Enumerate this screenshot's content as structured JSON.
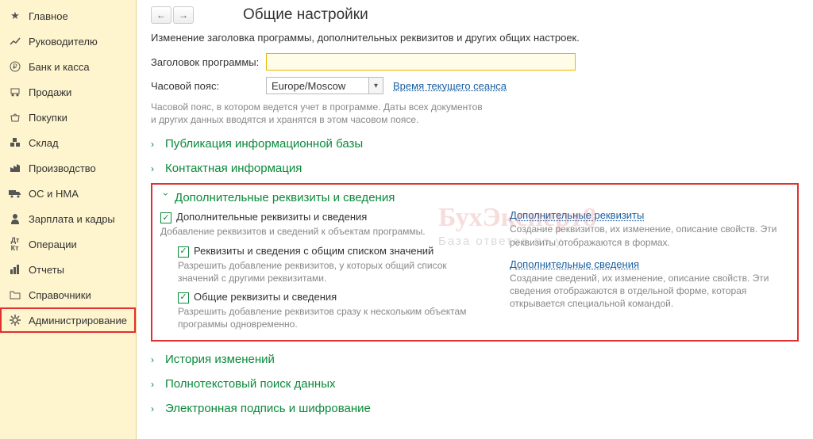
{
  "sidebar": {
    "items": [
      {
        "label": "Главное"
      },
      {
        "label": "Руководителю"
      },
      {
        "label": "Банк и касса"
      },
      {
        "label": "Продажи"
      },
      {
        "label": "Покупки"
      },
      {
        "label": "Склад"
      },
      {
        "label": "Производство"
      },
      {
        "label": "ОС и НМА"
      },
      {
        "label": "Зарплата и кадры"
      },
      {
        "label": "Операции"
      },
      {
        "label": "Отчеты"
      },
      {
        "label": "Справочники"
      },
      {
        "label": "Администрирование"
      }
    ]
  },
  "page": {
    "title": "Общие настройки",
    "description": "Изменение заголовка программы, дополнительных реквизитов и других общих настроек.",
    "program_title_label": "Заголовок программы:",
    "program_title_value": "",
    "timezone_label": "Часовой пояс:",
    "timezone_value": "Europe/Moscow",
    "session_time_link": "Время текущего сеанса",
    "timezone_hint": "Часовой пояс, в котором ведется учет в программе. Даты всех документов и других данных вводятся и хранятся в этом часовом поясе."
  },
  "sections": {
    "publication": "Публикация информационной базы",
    "contact": "Контактная информация",
    "additional": {
      "title": "Дополнительные реквизиты и сведения",
      "cb1": "Дополнительные реквизиты и сведения",
      "cb1_hint": "Добавление реквизитов и сведений к объектам программы.",
      "cb2": "Реквизиты и сведения с общим списком значений",
      "cb2_hint": "Разрешить добавление реквизитов, у которых общий список значений с другими реквизитами.",
      "cb3": "Общие реквизиты и сведения",
      "cb3_hint": "Разрешить добавление реквизитов сразу к нескольким объектам программы одновременно.",
      "rlink1": "Дополнительные реквизиты",
      "rdesc1": "Создание реквизитов, их изменение, описание свойств. Эти реквизиты отображаются в формах.",
      "rlink2": "Дополнительные сведения",
      "rdesc2": "Создание сведений, их изменение, описание свойств. Эти сведения отображаются в отдельной форме, которая открывается специальной командой."
    },
    "history": "История изменений",
    "fulltext": "Полнотекстовый поиск данных",
    "signature": "Электронная подпись и шифрование"
  },
  "watermark": {
    "line1": "БухЭксперт8",
    "line2": "База ответов по у"
  }
}
